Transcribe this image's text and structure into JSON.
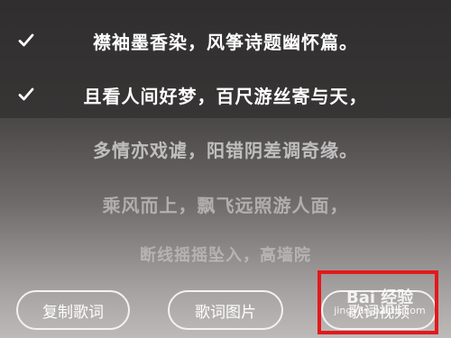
{
  "lyrics": [
    {
      "text": "襟袖墨香染，风筝诗题幽怀篇。",
      "checked": true
    },
    {
      "text": "且看人间好梦，百尺游丝寄与天，",
      "checked": true
    },
    {
      "text": "多情亦戏谑，阳错阴差调奇缘。",
      "checked": false
    },
    {
      "text": "乘风而上，飘飞远照游人面，",
      "checked": false
    },
    {
      "text": "断线摇摇坠入，高墙院",
      "checked": false
    }
  ],
  "buttons": {
    "copy": "复制歌词",
    "image": "歌词图片",
    "video": "歌词视频"
  },
  "watermark": {
    "logo": "Bai 经验",
    "url": "jingyan.baidu.com"
  },
  "colors": {
    "highlight": "#e4181b",
    "text": "#ffffff"
  }
}
